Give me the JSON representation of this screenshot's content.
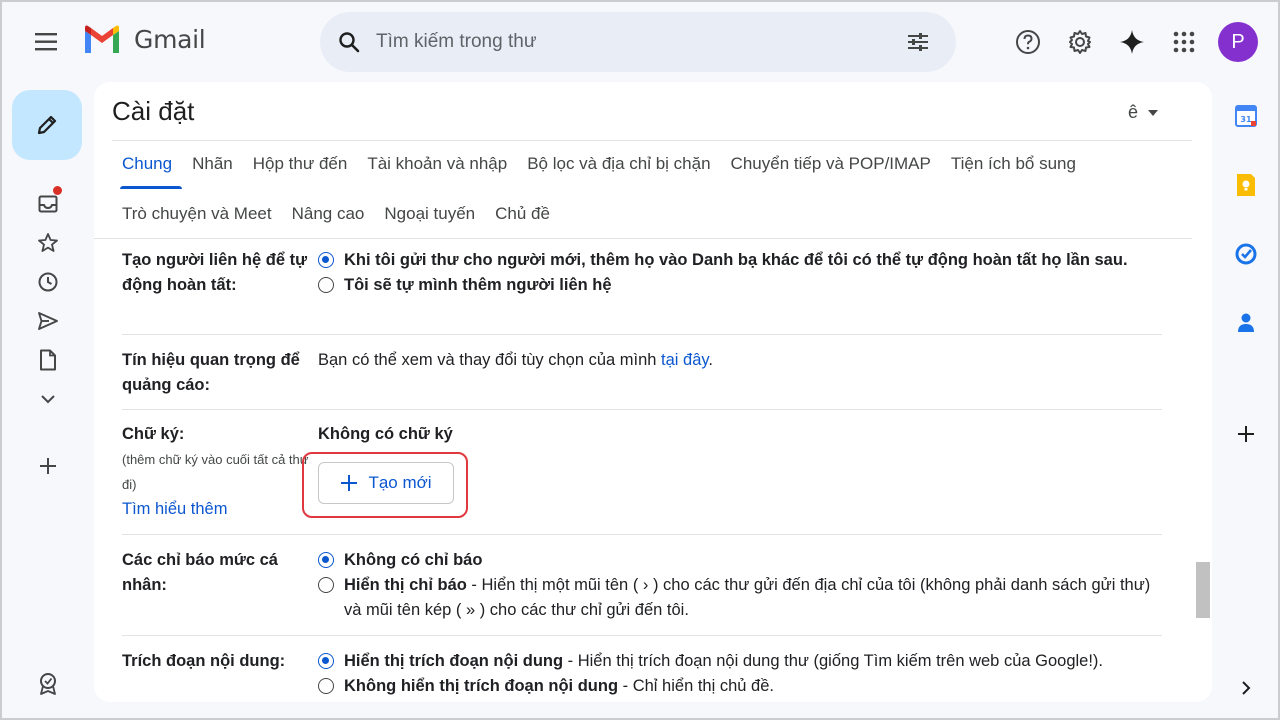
{
  "app": {
    "name": "Gmail"
  },
  "search": {
    "placeholder": "Tìm kiếm trong thư"
  },
  "account": {
    "initial": "P"
  },
  "colors": {
    "accent": "#0b57d0",
    "compose_bg": "#c2e7ff",
    "avatar_bg": "#8430ce",
    "highlight": "#e0383e"
  },
  "settings": {
    "title": "Cài đặt",
    "language_glyph": "ê",
    "tabs_row1": [
      "Chung",
      "Nhãn",
      "Hộp thư đến",
      "Tài khoản và nhập",
      "Bộ lọc và địa chỉ bị chặn",
      "Chuyển tiếp và POP/IMAP",
      "Tiện ích bổ sung"
    ],
    "tabs_row2": [
      "Trò chuyện và Meet",
      "Nâng cao",
      "Ngoại tuyến",
      "Chủ đề"
    ],
    "active_tab": "Chung",
    "contacts": {
      "label": "Tạo người liên hệ để tự động hoàn tất:",
      "option1": "Khi tôi gửi thư cho người mới, thêm họ vào Danh bạ khác để tôi có thể tự động hoàn tất họ lần sau.",
      "option2": "Tôi sẽ tự mình thêm người liên hệ"
    },
    "ads": {
      "label": "Tín hiệu quan trọng để quảng cáo:",
      "text": "Bạn có thể xem và thay đổi tùy chọn của mình ",
      "link": "tại đây",
      "end": "."
    },
    "signature": {
      "label": "Chữ ký:",
      "sub": "(thêm chữ ký vào cuối tất cả thư đi)",
      "learn_more": "Tìm hiểu thêm",
      "none": "Không có chữ ký",
      "create_button": "Tạo mới"
    },
    "indicators": {
      "label": "Các chỉ báo mức cá nhân:",
      "option1": "Không có chỉ báo",
      "option2_bold": "Hiển thị chỉ báo",
      "option2_rest": " - Hiển thị một mũi tên ( › ) cho các thư gửi đến địa chỉ của tôi (không phải danh sách gửi thư) và mũi tên kép ( » ) cho các thư chỉ gửi đến tôi."
    },
    "snippets": {
      "label": "Trích đoạn nội dung:",
      "option1_bold": "Hiển thị trích đoạn nội dung",
      "option1_rest": " - Hiển thị trích đoạn nội dung thư (giống Tìm kiếm trên web của Google!).",
      "option2_bold": "Không hiển thị trích đoạn nội dung",
      "option2_rest": " - Chỉ hiển thị chủ đề."
    }
  },
  "calendar_badge": "31"
}
